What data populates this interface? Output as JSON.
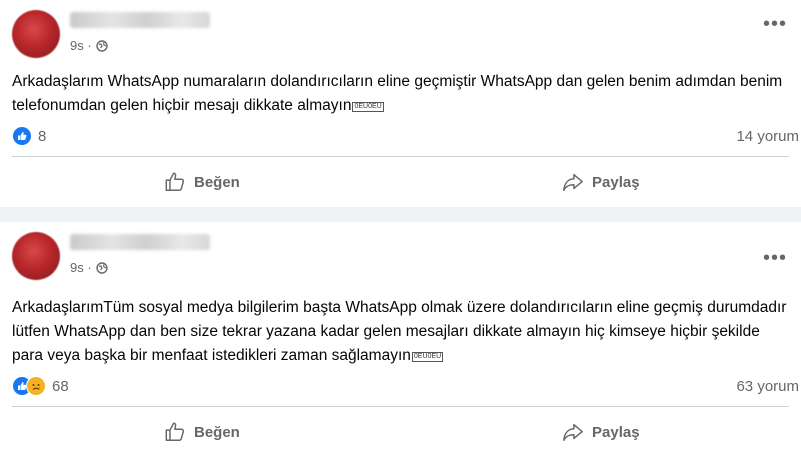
{
  "posts": [
    {
      "time": "9s ·",
      "text": "Arkadaşlarım WhatsApp numaraların dolandırıcıların eline geçmiştir WhatsApp dan gelen benim adımdan benim telefonumdan gelen hiçbir mesajı dikkate almayın",
      "emoji_fallback": "0EU0EU",
      "reaction_count": "8",
      "reactions": [
        "like"
      ],
      "comment_count": "14 yorum",
      "like_label": "Beğen",
      "share_label": "Paylaş"
    },
    {
      "time": "9s ·",
      "text": "ArkadaşlarımTüm sosyal medya bilgilerim başta WhatsApp olmak üzere dolandırıcıların eline geçmiş durumdadır lütfen WhatsApp dan ben size tekrar yazana kadar gelen mesajları dikkate almayın hiç kimseye hiçbir şekilde para veya başka bir menfaat istedikleri zaman sağlamayın",
      "emoji_fallback": "0EU0EU",
      "reaction_count": "68",
      "reactions": [
        "like",
        "sad"
      ],
      "comment_count": "63 yorum",
      "like_label": "Beğen",
      "share_label": "Paylaş"
    }
  ],
  "icons": {
    "more": "more-horizontal-icon",
    "privacy": "globe-icon",
    "like_action": "thumbs-up-outline-icon",
    "share_action": "share-arrow-icon",
    "like_reaction": "like-reaction-icon",
    "sad_reaction": "sad-reaction-icon"
  },
  "colors": {
    "accent": "#1877f2",
    "secondary_text": "#65676b",
    "background": "#f0f2f5"
  }
}
